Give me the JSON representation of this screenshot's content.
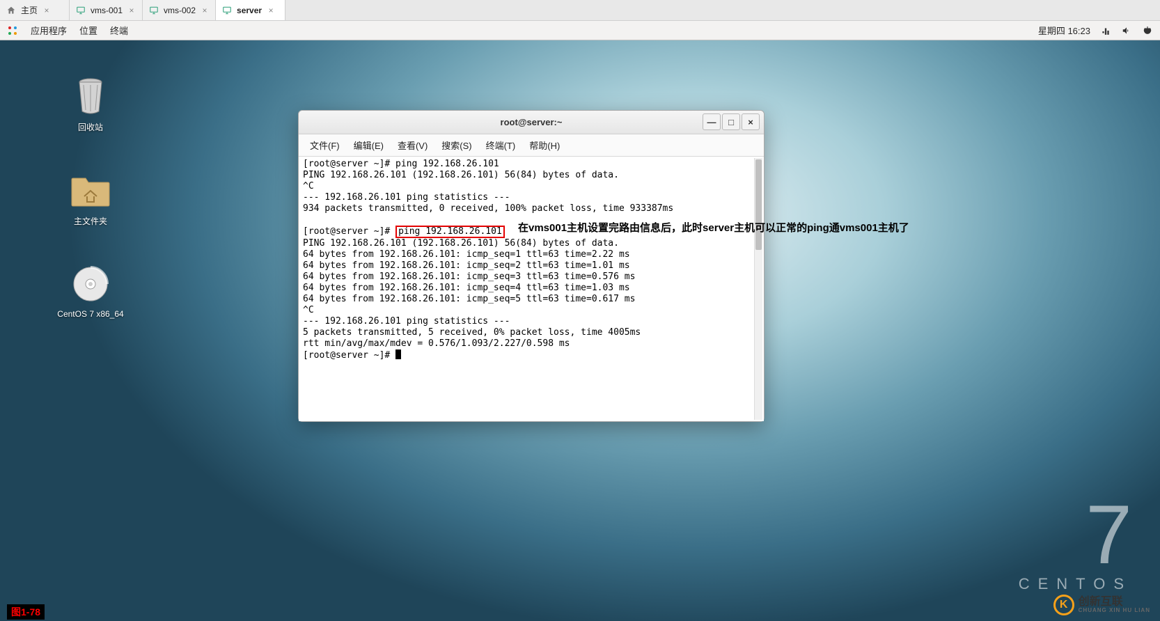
{
  "tabs": [
    {
      "label": "主页",
      "active": false,
      "icon": "home"
    },
    {
      "label": "vms-001",
      "active": false,
      "icon": "monitor"
    },
    {
      "label": "vms-002",
      "active": false,
      "icon": "monitor"
    },
    {
      "label": "server",
      "active": true,
      "icon": "monitor"
    }
  ],
  "panel": {
    "apps": "应用程序",
    "places": "位置",
    "terminal": "终端",
    "clock": "星期四 16:23"
  },
  "desktop_icons": {
    "trash": "回收站",
    "home": "主文件夹",
    "centos": "CentOS 7 x86_64"
  },
  "centos_wm": {
    "seven": "7",
    "word": "CENTOS"
  },
  "termwin": {
    "title": "root@server:~",
    "menu": {
      "file": "文件(F)",
      "edit": "编辑(E)",
      "view": "查看(V)",
      "search": "搜索(S)",
      "terminal": "终端(T)",
      "help": "帮助(H)"
    },
    "line1": "[root@server ~]# ping 192.168.26.101",
    "line2": "PING 192.168.26.101 (192.168.26.101) 56(84) bytes of data.",
    "line3": "^C",
    "line4": "--- 192.168.26.101 ping statistics ---",
    "line5": "934 packets transmitted, 0 received, 100% packet loss, time 933387ms",
    "blank": "",
    "prompt2": "[root@server ~]# ",
    "cmd2": "ping 192.168.26.101",
    "line7": "PING 192.168.26.101 (192.168.26.101) 56(84) bytes of data.",
    "line8": "64 bytes from 192.168.26.101: icmp_seq=1 ttl=63 time=2.22 ms",
    "line9": "64 bytes from 192.168.26.101: icmp_seq=2 ttl=63 time=1.01 ms",
    "line10": "64 bytes from 192.168.26.101: icmp_seq=3 ttl=63 time=0.576 ms",
    "line11": "64 bytes from 192.168.26.101: icmp_seq=4 ttl=63 time=1.03 ms",
    "line12": "64 bytes from 192.168.26.101: icmp_seq=5 ttl=63 time=0.617 ms",
    "line13": "^C",
    "line14": "--- 192.168.26.101 ping statistics ---",
    "line15": "5 packets transmitted, 5 received, 0% packet loss, time 4005ms",
    "line16": "rtt min/avg/max/mdev = 0.576/1.093/2.227/0.598 ms",
    "prompt3": "[root@server ~]# "
  },
  "annotation": "在vms001主机设置完路由信息后，此时server主机可以正常的ping通vms001主机了",
  "figlabel": "图1-78",
  "logo": {
    "cn": "创新互联",
    "en": "CHUANG XIN HU LIAN"
  },
  "close_x": "×",
  "winbtns": {
    "min": "—",
    "max": "□",
    "close": "×"
  }
}
